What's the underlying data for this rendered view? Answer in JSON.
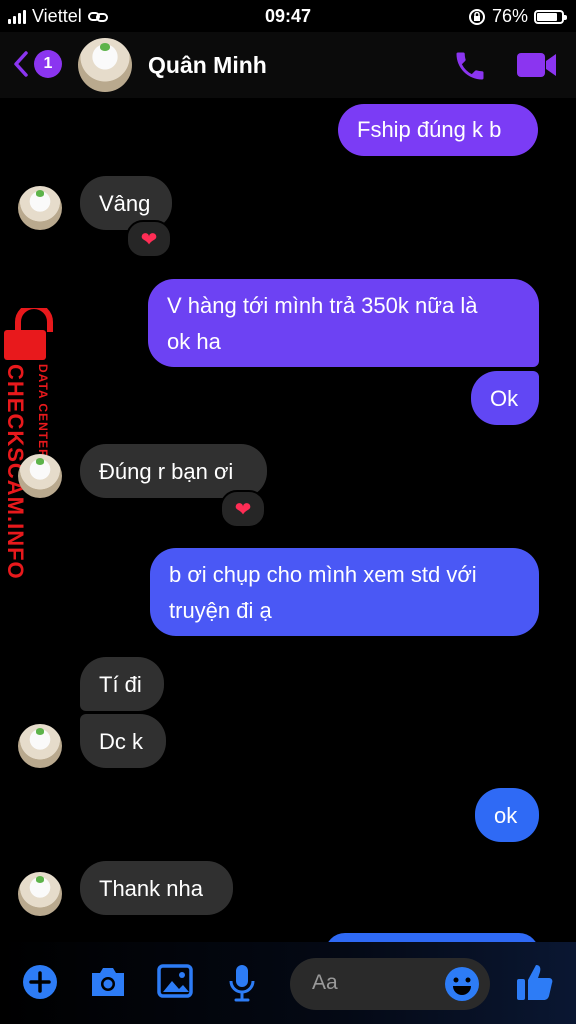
{
  "status_bar": {
    "carrier": "Viettel",
    "time": "09:47",
    "battery": "76%",
    "battery_level": 0.76
  },
  "header": {
    "unread_count": "1",
    "contact_name": "Quân Minh"
  },
  "messages": [
    {
      "text": "Fship đúng k b"
    },
    {
      "text": "Vâng",
      "reaction": "❤"
    },
    {
      "text": "V hàng tới mình trả 350k nữa là ok ha",
      "line1": "V hàng tới mình trả 350k nữa là",
      "line2": "ok ha"
    },
    {
      "text": "Ok"
    },
    {
      "text": "Đúng r bạn ơi",
      "reaction": "❤"
    },
    {
      "text": "b ơi chụp cho mình xem std với truyện đi ạ",
      "line1": "b ơi chụp cho mình xem std với",
      "line2": "truyện đi ạ"
    },
    {
      "text": "Tí đi"
    },
    {
      "text": "Dc k"
    },
    {
      "text": "ok"
    },
    {
      "text": "Thank nha"
    }
  ],
  "watermark": {
    "brand": "CHECKSCAM.INFO",
    "tagline": "DATA CENTER"
  },
  "composer": {
    "placeholder": "Aa"
  },
  "colors": {
    "accent": "#8b35f0",
    "incoming_bubble": "#303030",
    "outgoing_top": "#7b3cf5",
    "outgoing_bottom": "#2f6af5",
    "heart": "#ff2d55"
  }
}
